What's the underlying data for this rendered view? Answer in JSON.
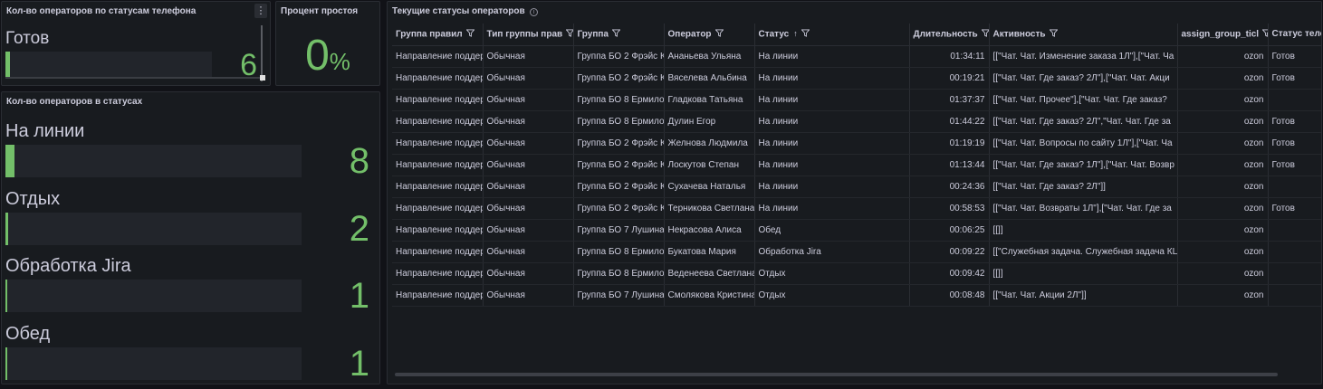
{
  "panel_phone_status": {
    "title": "Кол-во операторов по статусам телефона",
    "menu_icon": "⋮",
    "items": [
      {
        "label": "Готов",
        "value": "6",
        "fill_percent": 2
      }
    ]
  },
  "panel_idle": {
    "title": "Процент простоя",
    "value": "0",
    "unit": "%"
  },
  "panel_status_counts": {
    "title": "Кол-во операторов в статусах",
    "items": [
      {
        "label": "На линии",
        "value": "8",
        "fill_percent": 3
      },
      {
        "label": "Отдых",
        "value": "2",
        "fill_percent": 1
      },
      {
        "label": "Обработка Jira",
        "value": "1",
        "fill_percent": 0.5
      },
      {
        "label": "Обед",
        "value": "1",
        "fill_percent": 0.5
      }
    ]
  },
  "panel_table": {
    "title": "Текущие статусы операторов",
    "info_icon": "i",
    "sort_indicator": "↑",
    "columns": [
      {
        "label": "Группа правил",
        "filter": true
      },
      {
        "label": "Тип группы прав",
        "filter": true
      },
      {
        "label": "Группа",
        "filter": true
      },
      {
        "label": "Оператор",
        "filter": true
      },
      {
        "label": "Статус",
        "filter": true,
        "sorted": true
      },
      {
        "label": "Длительность",
        "filter": true
      },
      {
        "label": "Активность",
        "filter": true
      },
      {
        "label": "assign_group_ticl",
        "filter": true
      },
      {
        "label": "Статус теле",
        "filter": false
      }
    ],
    "rows": [
      [
        "Направление поддер",
        "Обычная",
        "Группа БО 2 Фрэйс К",
        "Ананьева Ульяна",
        "На линии",
        "01:34:11",
        "[[\"Чат. Чат. Изменение заказа 1Л\"],[\"Чат. Ча",
        "ozon",
        "Готов"
      ],
      [
        "Направление поддер",
        "Обычная",
        "Группа БО 2 Фрэйс К",
        "Вяселева Альбина",
        "На линии",
        "00:19:21",
        "[[\"Чат. Чат. Где заказ? 2Л\"],[\"Чат. Чат. Акци",
        "ozon",
        "Готов"
      ],
      [
        "Направление поддер",
        "Обычная",
        "Группа БО 8 Ермило",
        "Гладкова Татьяна",
        "На линии",
        "01:37:37",
        "[[\"Чат. Чат. Прочее\"],[\"Чат. Чат. Где заказ?",
        "ozon",
        ""
      ],
      [
        "Направление поддер",
        "Обычная",
        "Группа БО 8 Ермило",
        "Дулин Егор",
        "На линии",
        "01:44:22",
        "[[\"Чат. Чат. Где заказ? 2Л\",\"Чат. Чат. Где за",
        "ozon",
        "Готов"
      ],
      [
        "Направление поддер",
        "Обычная",
        "Группа БО 2 Фрэйс К",
        "Желнова Людмила",
        "На линии",
        "01:19:19",
        "[[\"Чат. Чат. Вопросы по сайту 1Л\"],[\"Чат. Ча",
        "ozon",
        "Готов"
      ],
      [
        "Направление поддер",
        "Обычная",
        "Группа БО 2 Фрэйс К",
        "Лоскутов Степан",
        "На линии",
        "01:13:44",
        "[[\"Чат. Чат. Где заказ? 1Л\"],[\"Чат. Чат. Возвр",
        "ozon",
        "Готов"
      ],
      [
        "Направление поддер",
        "Обычная",
        "Группа БО 2 Фрэйс К",
        "Сухачева Наталья",
        "На линии",
        "00:24:36",
        "[[\"Чат. Чат. Где заказ? 2Л\"]]",
        "ozon",
        ""
      ],
      [
        "Направление поддер",
        "Обычная",
        "Группа БО 2 Фрэйс К",
        "Терникова Светлана",
        "На линии",
        "00:58:53",
        "[[\"Чат. Чат. Возвраты 1Л\"],[\"Чат. Чат. Где за",
        "ozon",
        "Готов"
      ],
      [
        "Направление поддер",
        "Обычная",
        "Группа БО 7 Лушина",
        "Некрасова Алиса",
        "Обед",
        "00:06:25",
        "[[]]",
        "ozon",
        ""
      ],
      [
        "Направление поддер",
        "Обычная",
        "Группа БО 8 Ермило",
        "Букатова Мария",
        "Обработка Jira",
        "00:09:22",
        "[[\"Служебная задача. Служебная задача КЦ",
        "ozon",
        ""
      ],
      [
        "Направление поддер",
        "Обычная",
        "Группа БО 8 Ермило",
        "Веденеева Светлана",
        "Отдых",
        "00:09:42",
        "[[]]",
        "ozon",
        ""
      ],
      [
        "Направление поддер",
        "Обычная",
        "Группа БО 7 Лушина",
        "Смолякова Кристина",
        "Отдых",
        "00:08:48",
        "[[\"Чат. Чат. Акции 2Л\"]]",
        "ozon",
        ""
      ]
    ]
  },
  "colors": {
    "background": "#111217",
    "panel": "#181b1f",
    "accent_green": "#73bf69",
    "text": "#ccccdc"
  }
}
